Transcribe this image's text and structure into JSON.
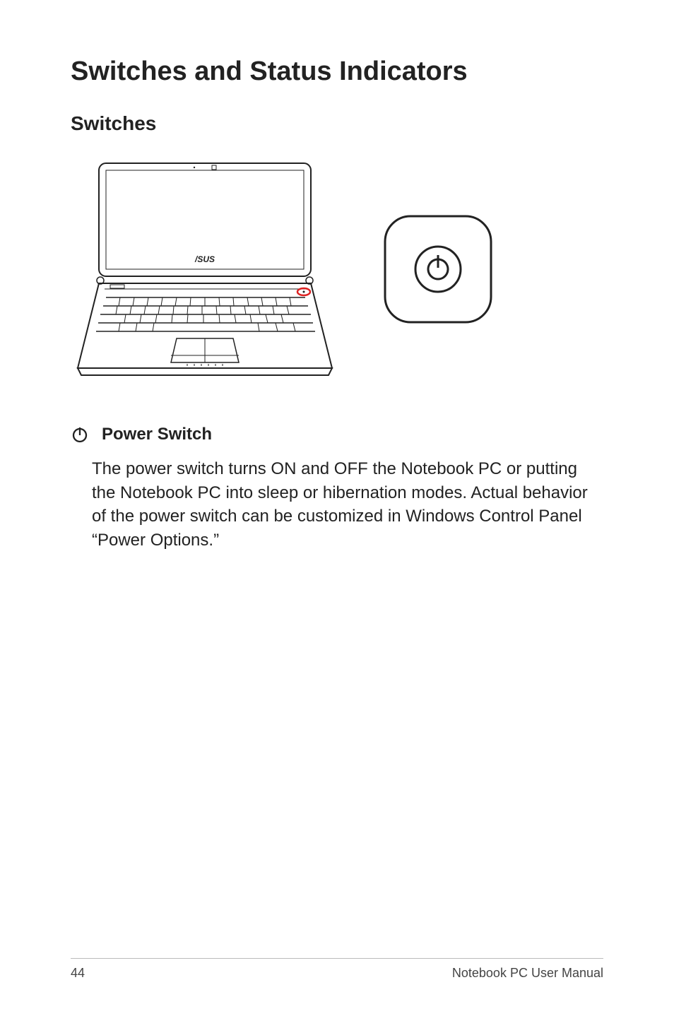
{
  "page": {
    "title": "Switches and Status Indicators",
    "subtitle": "Switches"
  },
  "switch": {
    "title": "Power Switch",
    "description": "The power switch turns ON and OFF the Notebook PC or putting the Notebook PC into sleep or hibernation modes. Actual behavior of the power switch can be customized in Windows Control Panel “Power Options.”"
  },
  "footer": {
    "page_number": "44",
    "manual_label": "Notebook PC User Manual"
  }
}
